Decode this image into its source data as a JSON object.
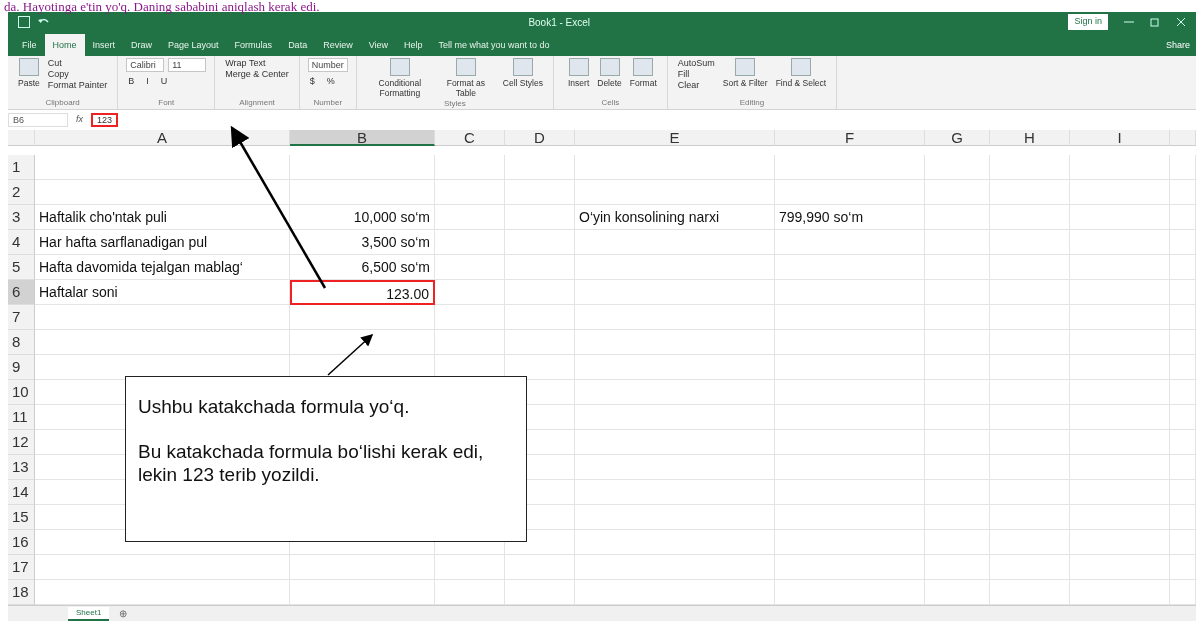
{
  "page_heading": "da. Hayotinga e'tin yo'q. Daning sababini aniqlash kerak edi.",
  "window": {
    "title": "Book1 - Excel",
    "sign_in": "Sign in"
  },
  "tabs": [
    {
      "label": "File",
      "selected": false
    },
    {
      "label": "Home",
      "selected": true
    },
    {
      "label": "Insert",
      "selected": false
    },
    {
      "label": "Draw",
      "selected": false
    },
    {
      "label": "Page Layout",
      "selected": false
    },
    {
      "label": "Formulas",
      "selected": false
    },
    {
      "label": "Data",
      "selected": false
    },
    {
      "label": "Review",
      "selected": false
    },
    {
      "label": "View",
      "selected": false
    },
    {
      "label": "Help",
      "selected": false
    }
  ],
  "tell_me": "Tell me what you want to do",
  "share": "Share",
  "ribbon": [
    {
      "name": "Clipboard",
      "large": [
        "Paste"
      ],
      "small": [
        "Cut",
        "Copy",
        "Format Painter"
      ]
    },
    {
      "name": "Font",
      "fields": [
        "Calibri",
        "11"
      ],
      "small": [
        "B",
        "I",
        "U"
      ]
    },
    {
      "name": "Alignment",
      "small": [
        "Wrap Text",
        "Merge & Center"
      ]
    },
    {
      "name": "Number",
      "fields": [
        "Number"
      ],
      "small": [
        "$",
        "%"
      ]
    },
    {
      "name": "Styles",
      "large": [
        "Conditional Formatting",
        "Format as Table",
        "Cell Styles"
      ]
    },
    {
      "name": "Cells",
      "large": [
        "Insert",
        "Delete",
        "Format"
      ]
    },
    {
      "name": "Editing",
      "small": [
        "AutoSum",
        "Fill",
        "Clear"
      ],
      "large": [
        "Sort & Filter",
        "Find & Select"
      ]
    }
  ],
  "formula_bar": {
    "name_box": "B6",
    "fx": "fx",
    "value": "123"
  },
  "columns": [
    {
      "label": "A",
      "selected": false
    },
    {
      "label": "B",
      "selected": true
    },
    {
      "label": "C",
      "selected": false
    },
    {
      "label": "D",
      "selected": false
    },
    {
      "label": "E",
      "selected": false
    },
    {
      "label": "F",
      "selected": false
    },
    {
      "label": "G",
      "selected": false
    },
    {
      "label": "H",
      "selected": false
    },
    {
      "label": "I",
      "selected": false
    }
  ],
  "rows": [
    {
      "number": "1",
      "selected": false
    },
    {
      "number": "2",
      "selected": false
    },
    {
      "number": "3",
      "selected": false,
      "column_a": "Haftalik cho'ntak puli",
      "column_b": "10,000 so‘m",
      "column_e": "O‘yin konsolining narxi",
      "column_f": "799,990 so‘m"
    },
    {
      "number": "4",
      "selected": false,
      "column_a": "Har hafta sarflanadigan pul",
      "column_b": "3,500 so‘m"
    },
    {
      "number": "5",
      "selected": false,
      "column_a": "Hafta davomida tejalgan mablag‘",
      "column_b": "6,500 so‘m"
    },
    {
      "number": "6",
      "selected": true,
      "column_a": "Haftalar soni",
      "column_b": "123.00"
    },
    {
      "number": "7",
      "selected": false
    },
    {
      "number": "8",
      "selected": false
    },
    {
      "number": "9",
      "selected": false
    },
    {
      "number": "10",
      "selected": false
    },
    {
      "number": "11",
      "selected": false
    },
    {
      "number": "12",
      "selected": false
    },
    {
      "number": "13",
      "selected": false
    },
    {
      "number": "14",
      "selected": false
    },
    {
      "number": "15",
      "selected": false
    },
    {
      "number": "16",
      "selected": false
    },
    {
      "number": "17",
      "selected": false
    },
    {
      "number": "18",
      "selected": false
    }
  ],
  "callout": [
    "Ushbu katakchada formula yo‘q.",
    "Bu katakchada formula bo‘lishi kerak edi, lekin 123 terib yozildi."
  ],
  "sheet_tabs": [
    {
      "label": "Sheet1",
      "selected": true
    }
  ],
  "add_sheet": "⊕"
}
